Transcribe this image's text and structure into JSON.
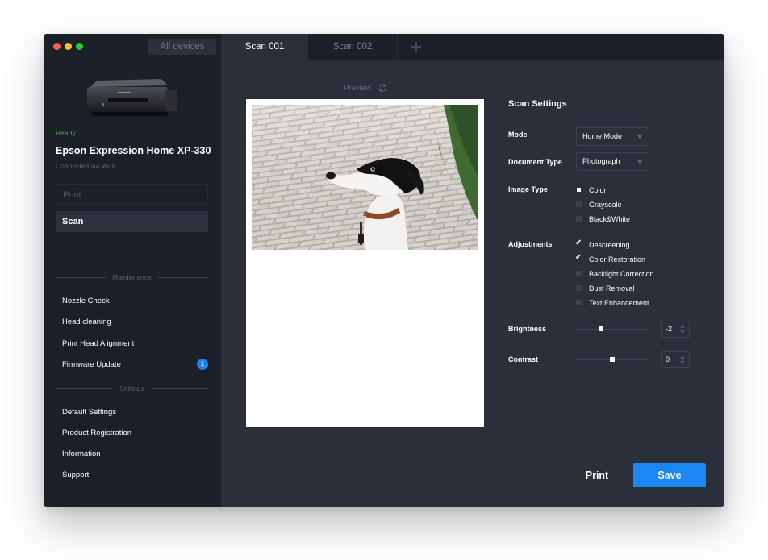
{
  "tabs": {
    "all_devices": "All devices",
    "items": [
      {
        "label": "Scan 001",
        "active": true
      },
      {
        "label": "Scan 002",
        "active": false
      }
    ],
    "add_icon": "plus-icon"
  },
  "sidebar": {
    "status": "Ready",
    "device_name": "Epson Expression Home XP-330",
    "connection": "Connected via Wi-fi",
    "print_label": "Print",
    "scan_label": "Scan",
    "maintenance_header": "Maintenance",
    "maintenance_items": [
      "Nozzle Check",
      "Head cleaning",
      "Print Head Alignment",
      "Firmware Update"
    ],
    "firmware_badge": "1",
    "settings_header": "Settings",
    "settings_items": [
      "Default Settings",
      "Product Registration",
      "Information",
      "Support"
    ]
  },
  "preview": {
    "label": "Preview",
    "refresh_icon": "refresh-icon"
  },
  "scan_settings": {
    "title": "Scan Settings",
    "mode_label": "Mode",
    "mode_value": "Home Mode",
    "doc_type_label": "Document Type",
    "doc_type_value": "Photograph",
    "image_type_label": "Image Type",
    "image_types": [
      {
        "label": "Color",
        "selected": true
      },
      {
        "label": "Grayscale",
        "selected": false
      },
      {
        "label": "Black&White",
        "selected": false
      }
    ],
    "adjustments_label": "Adjustments",
    "adjustments": [
      {
        "label": "Descreening",
        "checked": true
      },
      {
        "label": "Color Restoration",
        "checked": true
      },
      {
        "label": "Backlight Correction",
        "checked": false
      },
      {
        "label": "Dust Removal",
        "checked": false
      },
      {
        "label": "Text Enhancement",
        "checked": false
      }
    ],
    "brightness_label": "Brightness",
    "brightness_value": "-2",
    "brightness_level": 0.35,
    "contrast_label": "Contrast",
    "contrast_value": "0",
    "contrast_level": 0.5
  },
  "actions": {
    "print_label": "Print",
    "save_label": "Save"
  },
  "colors": {
    "accent": "#1b87f4",
    "status_ready": "#3fae3c",
    "window_bg": "#2a2f3a",
    "sidebar_bg": "#1b1f27"
  }
}
